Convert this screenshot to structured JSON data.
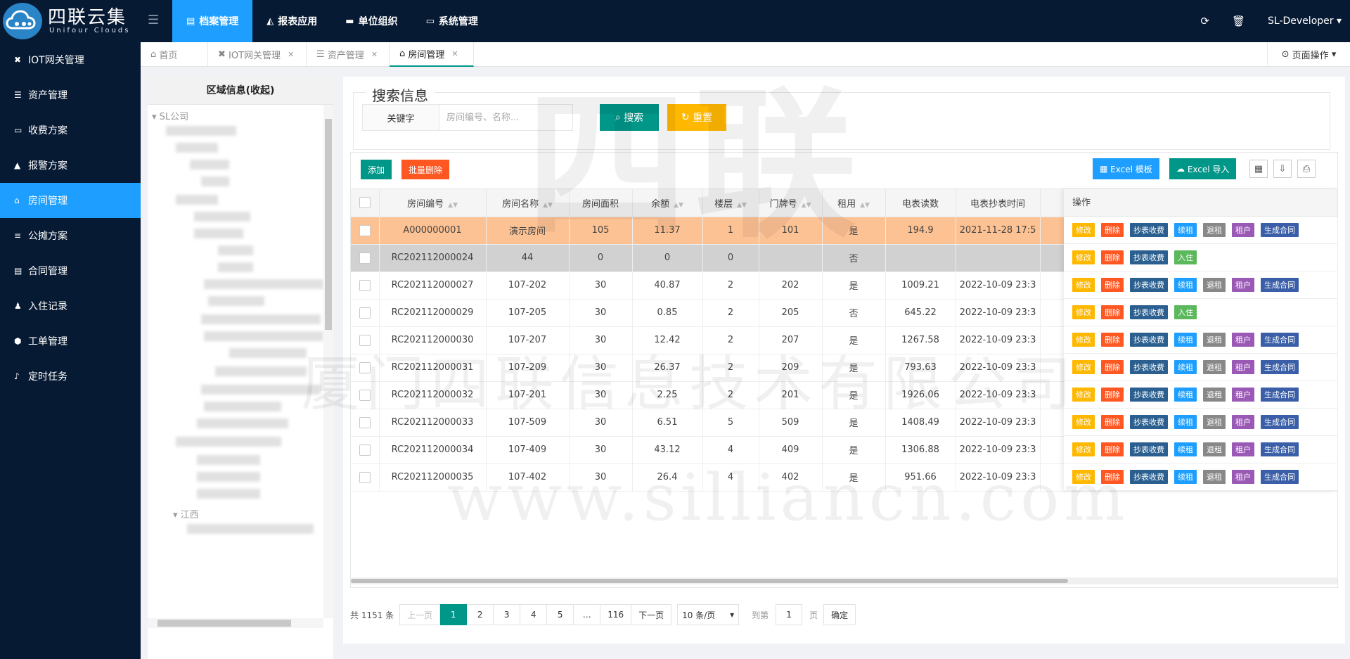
{
  "brand": {
    "name": "四联云集",
    "subtitle": "Unifour Clouds"
  },
  "topnav": [
    {
      "label": "档案管理",
      "icon": "file-icon",
      "active": true
    },
    {
      "label": "报表应用",
      "icon": "chart-icon",
      "active": false
    },
    {
      "label": "单位组织",
      "icon": "org-icon",
      "active": false
    },
    {
      "label": "系统管理",
      "icon": "monitor-icon",
      "active": false
    }
  ],
  "topright": {
    "user": "SL-Developer"
  },
  "sidebar": [
    {
      "label": "IOT网关管理",
      "icon": "gateway-icon"
    },
    {
      "label": "资产管理",
      "icon": "list-icon"
    },
    {
      "label": "收费方案",
      "icon": "card-icon"
    },
    {
      "label": "报警方案",
      "icon": "warning-icon"
    },
    {
      "label": "房间管理",
      "icon": "bank-icon",
      "active": true
    },
    {
      "label": "公摊方案",
      "icon": "bars-icon"
    },
    {
      "label": "合同管理",
      "icon": "document-icon"
    },
    {
      "label": "入住记录",
      "icon": "user-add-icon"
    },
    {
      "label": "工单管理",
      "icon": "cube-icon"
    },
    {
      "label": "定时任务",
      "icon": "bell-icon"
    }
  ],
  "tabs": [
    {
      "label": "首页",
      "icon": "home-icon",
      "closable": false
    },
    {
      "label": "IOT网关管理",
      "icon": "gateway-icon",
      "closable": true
    },
    {
      "label": "资产管理",
      "icon": "list-icon",
      "closable": true
    },
    {
      "label": "房间管理",
      "icon": "bank-icon",
      "closable": true,
      "active": true
    }
  ],
  "page_ops": "页面操作",
  "tree": {
    "title": "区域信息(收起)",
    "root": "SL公司",
    "node_jiangxi": "江西"
  },
  "search": {
    "legend": "搜索信息",
    "keyword_label": "关键字",
    "placeholder": "房间编号、名称...",
    "search_btn": "搜索",
    "reset_btn": "重置"
  },
  "toolbar": {
    "add": "添加",
    "batch_delete": "批量删除",
    "excel_template": "Excel 模板",
    "excel_import": "Excel 导入"
  },
  "table": {
    "columns": [
      "房间编号",
      "房间名称",
      "房间面积",
      "余额",
      "楼层",
      "门牌号",
      "租用",
      "电表读数",
      "电表抄表时间"
    ],
    "ops_header": "操作",
    "rows": [
      {
        "code": "A000000001",
        "name": "演示房间",
        "area": "105",
        "balance": "11.37",
        "floor": "1",
        "door": "101",
        "rented": "是",
        "meter": "194.9",
        "time": "2021-11-28 17:5",
        "style": "hl",
        "ops": [
          "修改",
          "删除",
          "抄表收费",
          "续租",
          "退租",
          "租户",
          "生成合同"
        ]
      },
      {
        "code": "RC202112000024",
        "name": "44",
        "area": "0",
        "balance": "0",
        "floor": "0",
        "door": "",
        "rented": "否",
        "meter": "",
        "time": "",
        "style": "gray",
        "ops": [
          "修改",
          "删除",
          "抄表收费",
          "入住"
        ]
      },
      {
        "code": "RC202112000027",
        "name": "107-202",
        "area": "30",
        "balance": "40.87",
        "floor": "2",
        "door": "202",
        "rented": "是",
        "meter": "1009.21",
        "time": "2022-10-09 23:3",
        "style": "",
        "ops": [
          "修改",
          "删除",
          "抄表收费",
          "续租",
          "退租",
          "租户",
          "生成合同"
        ]
      },
      {
        "code": "RC202112000029",
        "name": "107-205",
        "area": "30",
        "balance": "0.85",
        "floor": "2",
        "door": "205",
        "rented": "否",
        "meter": "645.22",
        "time": "2022-10-09 23:3",
        "style": "",
        "ops": [
          "修改",
          "删除",
          "抄表收费",
          "入住"
        ]
      },
      {
        "code": "RC202112000030",
        "name": "107-207",
        "area": "30",
        "balance": "12.42",
        "floor": "2",
        "door": "207",
        "rented": "是",
        "meter": "1267.58",
        "time": "2022-10-09 23:3",
        "style": "",
        "ops": [
          "修改",
          "删除",
          "抄表收费",
          "续租",
          "退租",
          "租户",
          "生成合同"
        ]
      },
      {
        "code": "RC202112000031",
        "name": "107-209",
        "area": "30",
        "balance": "26.37",
        "floor": "2",
        "door": "209",
        "rented": "是",
        "meter": "793.63",
        "time": "2022-10-09 23:3",
        "style": "",
        "ops": [
          "修改",
          "删除",
          "抄表收费",
          "续租",
          "退租",
          "租户",
          "生成合同"
        ]
      },
      {
        "code": "RC202112000032",
        "name": "107-201",
        "area": "30",
        "balance": "2.25",
        "floor": "2",
        "door": "201",
        "rented": "是",
        "meter": "1926.06",
        "time": "2022-10-09 23:3",
        "style": "",
        "ops": [
          "修改",
          "删除",
          "抄表收费",
          "续租",
          "退租",
          "租户",
          "生成合同"
        ]
      },
      {
        "code": "RC202112000033",
        "name": "107-509",
        "area": "30",
        "balance": "6.51",
        "floor": "5",
        "door": "509",
        "rented": "是",
        "meter": "1408.49",
        "time": "2022-10-09 23:3",
        "style": "",
        "ops": [
          "修改",
          "删除",
          "抄表收费",
          "续租",
          "退租",
          "租户",
          "生成合同"
        ]
      },
      {
        "code": "RC202112000034",
        "name": "107-409",
        "area": "30",
        "balance": "43.12",
        "floor": "4",
        "door": "409",
        "rented": "是",
        "meter": "1306.88",
        "time": "2022-10-09 23:3",
        "style": "",
        "ops": [
          "修改",
          "删除",
          "抄表收费",
          "续租",
          "退租",
          "租户",
          "生成合同"
        ]
      },
      {
        "code": "RC202112000035",
        "name": "107-402",
        "area": "30",
        "balance": "26.4",
        "floor": "4",
        "door": "402",
        "rented": "是",
        "meter": "951.66",
        "time": "2022-10-09 23:3",
        "style": "",
        "ops": [
          "修改",
          "删除",
          "抄表收费",
          "续租",
          "退租",
          "租户",
          "生成合同"
        ]
      }
    ]
  },
  "pager": {
    "total": "共 1151 条",
    "prev": "上一页",
    "pages": [
      "1",
      "2",
      "3",
      "4",
      "5",
      "…",
      "116"
    ],
    "next": "下一页",
    "page_size": "10 条/页",
    "goto": "到第",
    "goto_value": "1",
    "goto_unit": "页",
    "confirm": "确定"
  },
  "watermark": {
    "company": "厦门四联信息技术有限公司",
    "site": "www.silliancn.com",
    "logo": "四联"
  }
}
